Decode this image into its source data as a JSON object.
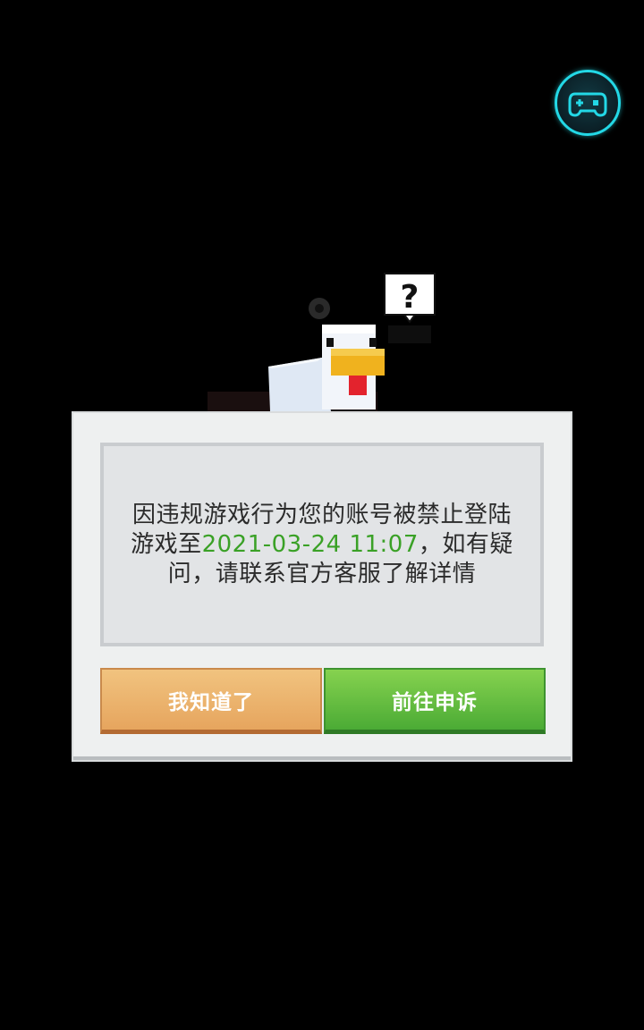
{
  "dialog": {
    "message_part1": "因违规游戏行为您的账号被禁止登陆游戏至",
    "ban_until": "2021-03-24 11:07",
    "message_part2": "，如有疑问，请联系官方客服了解详情",
    "ok_label": "我知道了",
    "appeal_label": "前往申诉"
  },
  "icons": {
    "fab": "gamepad-icon",
    "mascot": "chicken-mascot",
    "bubble": "question-mark-icon"
  },
  "colors": {
    "background": "#000000",
    "accent_cyan": "#23d8e6",
    "date_green": "#3aa126",
    "ok_button": "#e6a55e",
    "appeal_button": "#4bab35"
  }
}
